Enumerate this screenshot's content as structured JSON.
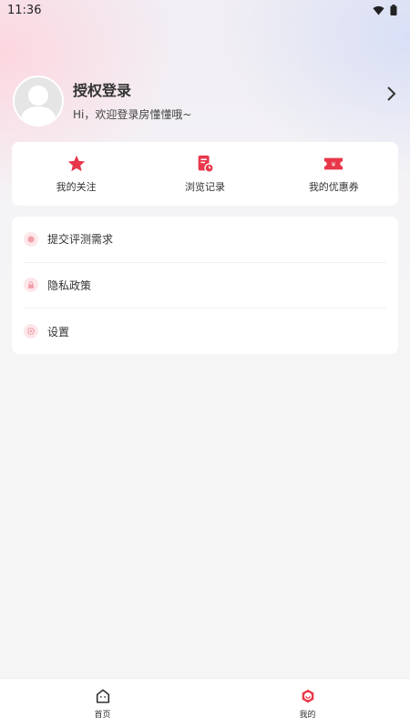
{
  "status_bar": {
    "time": "11:36"
  },
  "profile": {
    "title": "授权登录",
    "subtitle": "Hi，欢迎登录房懂懂哦~"
  },
  "quick_actions": [
    {
      "label": "我的关注",
      "icon": "star-icon"
    },
    {
      "label": "浏览记录",
      "icon": "history-icon"
    },
    {
      "label": "我的优惠券",
      "icon": "coupon-icon"
    }
  ],
  "menu": [
    {
      "label": "提交评测需求",
      "icon": "evaluation-icon"
    },
    {
      "label": "隐私政策",
      "icon": "lock-icon"
    },
    {
      "label": "设置",
      "icon": "gear-icon"
    }
  ],
  "tabbar": [
    {
      "label": "首页",
      "icon": "home-icon",
      "active": false
    },
    {
      "label": "我的",
      "icon": "profile-icon",
      "active": true
    }
  ],
  "colors": {
    "accent": "#e8374a",
    "icon_bg": "#fde7ea"
  }
}
